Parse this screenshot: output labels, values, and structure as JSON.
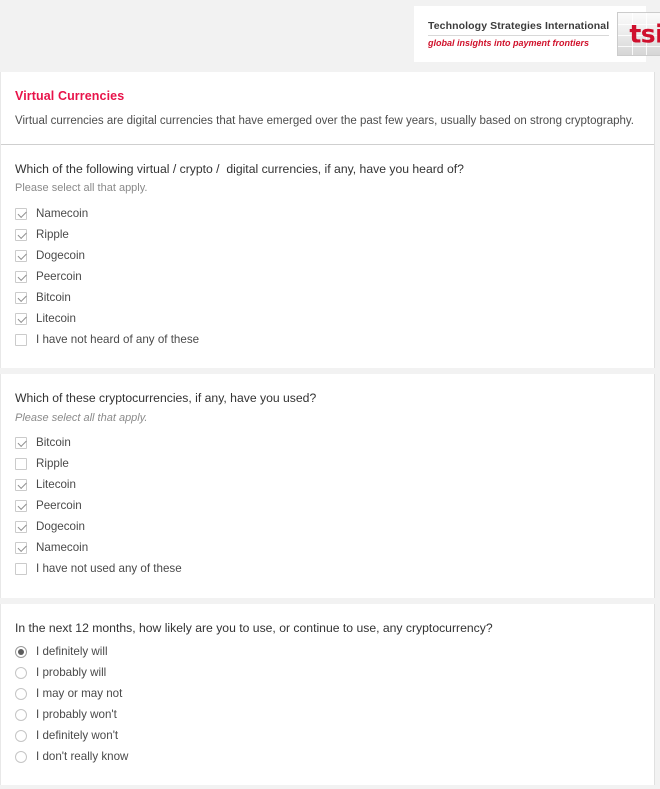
{
  "branding": {
    "company_name": "Technology Strategies International",
    "tagline": "global insights into payment frontiers",
    "logo_mark_text": "tsi",
    "accent_red": "#cf102d",
    "title_pink": "#e8134a"
  },
  "intro": {
    "title": "Virtual Currencies",
    "description": "Virtual currencies are digital currencies that have emerged over the past few years, usually based on strong cryptography."
  },
  "questions": [
    {
      "title": "Which of the following virtual / crypto /  digital currencies, if any, have you heard of?",
      "subtitle": "Please select all that apply.",
      "subtitle_italic": false,
      "input_type": "checkbox",
      "options": [
        {
          "label": "Namecoin",
          "checked": true
        },
        {
          "label": "Ripple",
          "checked": true
        },
        {
          "label": "Dogecoin",
          "checked": true
        },
        {
          "label": "Peercoin",
          "checked": true
        },
        {
          "label": "Bitcoin",
          "checked": true
        },
        {
          "label": "Litecoin",
          "checked": true
        },
        {
          "label": "I have not heard of any of these",
          "checked": false
        }
      ]
    },
    {
      "title": "Which of these cryptocurrencies, if any, have you used?",
      "subtitle": "Please select all that apply.",
      "subtitle_italic": true,
      "input_type": "checkbox",
      "options": [
        {
          "label": "Bitcoin",
          "checked": true
        },
        {
          "label": "Ripple",
          "checked": false
        },
        {
          "label": "Litecoin",
          "checked": true
        },
        {
          "label": "Peercoin",
          "checked": true
        },
        {
          "label": "Dogecoin",
          "checked": true
        },
        {
          "label": "Namecoin",
          "checked": true
        },
        {
          "label": "I have not used any of these",
          "checked": false
        }
      ]
    },
    {
      "title": "In the next 12 months, how likely are you to use, or continue to use, any cryptocurrency?",
      "subtitle": "",
      "subtitle_italic": false,
      "input_type": "radio",
      "options": [
        {
          "label": "I definitely will",
          "checked": true
        },
        {
          "label": "I probably will",
          "checked": false
        },
        {
          "label": "I may or may not",
          "checked": false
        },
        {
          "label": "I probably won't",
          "checked": false
        },
        {
          "label": "I definitely won't",
          "checked": false
        },
        {
          "label": "I don't really know",
          "checked": false
        }
      ]
    }
  ]
}
